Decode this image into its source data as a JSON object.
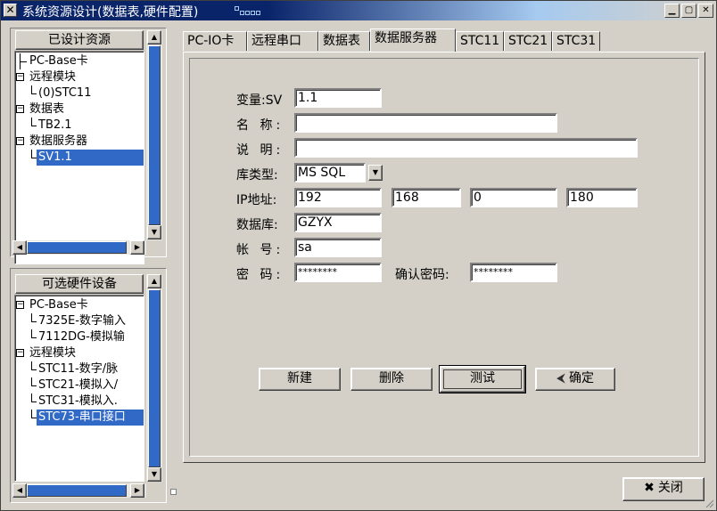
{
  "window": {
    "title": "系统资源设计(数据表,硬件配置)",
    "controls": [
      "minimize-icon",
      "maximize-icon",
      "close-icon"
    ]
  },
  "designed_panel": {
    "header": "已设计资源",
    "items": [
      {
        "label": "PC-Base卡",
        "level": 0,
        "expander": ""
      },
      {
        "label": "远程模块",
        "level": 0,
        "expander": "−"
      },
      {
        "label": "(0)STC11",
        "level": 1,
        "expander": ""
      },
      {
        "label": "数据表",
        "level": 0,
        "expander": "−"
      },
      {
        "label": "TB2.1",
        "level": 1,
        "expander": ""
      },
      {
        "label": "数据服务器",
        "level": 0,
        "expander": "−"
      },
      {
        "label": "SV1.1",
        "level": 1,
        "expander": "",
        "selected": true
      }
    ]
  },
  "hardware_panel": {
    "header": "可选硬件设备",
    "items": [
      {
        "label": "PC-Base卡",
        "level": 0,
        "expander": "−"
      },
      {
        "label": "7325E-数字输入",
        "level": 1,
        "expander": ""
      },
      {
        "label": "7112DG-模拟输",
        "level": 1,
        "expander": ""
      },
      {
        "label": "远程模块",
        "level": 0,
        "expander": "−"
      },
      {
        "label": "STC11-数字/脉",
        "level": 1,
        "expander": ""
      },
      {
        "label": "STC21-模拟入/",
        "level": 1,
        "expander": ""
      },
      {
        "label": "STC31-模拟入.",
        "level": 1,
        "expander": ""
      },
      {
        "label": "STC73-串口接口",
        "level": 1,
        "expander": "",
        "selected": true
      }
    ]
  },
  "tabs": [
    {
      "label": "PC-IO卡"
    },
    {
      "label": "远程串口"
    },
    {
      "label": "数据表"
    },
    {
      "label": "数据服务器",
      "active": true
    },
    {
      "label": "STC11"
    },
    {
      "label": "STC21"
    },
    {
      "label": "STC31"
    }
  ],
  "form": {
    "var_label": "变量:SV",
    "var_value": "1.1",
    "name_label": "名  称:",
    "name_value": "",
    "desc_label": "说  明:",
    "desc_value": "",
    "dbtype_label": "库类型:",
    "dbtype_value": "MS SQL",
    "ip_label": "IP地址:",
    "ip": [
      "192",
      "168",
      "0",
      "180"
    ],
    "db_label": "数据库:",
    "db_value": "GZYX",
    "account_label": "帐  号:",
    "account_value": "sa",
    "password_label": "密  码:",
    "password_value": "********",
    "confirm_label": "确认密码:",
    "confirm_value": "********"
  },
  "buttons": {
    "new": "新建",
    "delete": "删除",
    "test": "测试",
    "ok": "确定",
    "close": "关闭"
  },
  "colors": {
    "selection": "#3169c6",
    "titlebar": "#0a246a",
    "face": "#d4d0c8"
  }
}
